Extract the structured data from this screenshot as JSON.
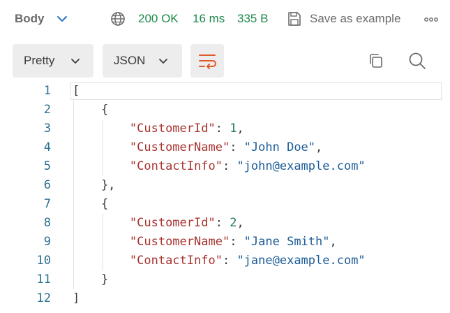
{
  "top_bar": {
    "body_label": "Body",
    "status_code": "200 OK",
    "time": "16 ms",
    "size": "335 B",
    "save_label": "Save as example",
    "status_color": "#1e8a4c",
    "icons": [
      "chevron-down-icon",
      "globe-icon",
      "save-icon",
      "more-horizontal-icon"
    ]
  },
  "toolbar": {
    "format_dropdown": "Pretty",
    "language_dropdown": "JSON",
    "icons": [
      "wrap-lines-icon",
      "copy-icon",
      "search-icon"
    ],
    "accent_color": "#e05a2b"
  },
  "code": {
    "line_numbers": [
      "1",
      "2",
      "3",
      "4",
      "5",
      "6",
      "7",
      "8",
      "9",
      "10",
      "11",
      "12"
    ],
    "lines": [
      [
        {
          "t": "p",
          "v": "["
        }
      ],
      [
        {
          "t": "p",
          "v": "    {"
        }
      ],
      [
        {
          "t": "p",
          "v": "        "
        },
        {
          "t": "k",
          "v": "\"CustomerId\""
        },
        {
          "t": "p",
          "v": ": "
        },
        {
          "t": "n",
          "v": "1"
        },
        {
          "t": "p",
          "v": ","
        }
      ],
      [
        {
          "t": "p",
          "v": "        "
        },
        {
          "t": "k",
          "v": "\"CustomerName\""
        },
        {
          "t": "p",
          "v": ": "
        },
        {
          "t": "s",
          "v": "\"John Doe\""
        },
        {
          "t": "p",
          "v": ","
        }
      ],
      [
        {
          "t": "p",
          "v": "        "
        },
        {
          "t": "k",
          "v": "\"ContactInfo\""
        },
        {
          "t": "p",
          "v": ": "
        },
        {
          "t": "s",
          "v": "\"john@example.com\""
        }
      ],
      [
        {
          "t": "p",
          "v": "    },"
        }
      ],
      [
        {
          "t": "p",
          "v": "    {"
        }
      ],
      [
        {
          "t": "p",
          "v": "        "
        },
        {
          "t": "k",
          "v": "\"CustomerId\""
        },
        {
          "t": "p",
          "v": ": "
        },
        {
          "t": "n",
          "v": "2"
        },
        {
          "t": "p",
          "v": ","
        }
      ],
      [
        {
          "t": "p",
          "v": "        "
        },
        {
          "t": "k",
          "v": "\"CustomerName\""
        },
        {
          "t": "p",
          "v": ": "
        },
        {
          "t": "s",
          "v": "\"Jane Smith\""
        },
        {
          "t": "p",
          "v": ","
        }
      ],
      [
        {
          "t": "p",
          "v": "        "
        },
        {
          "t": "k",
          "v": "\"ContactInfo\""
        },
        {
          "t": "p",
          "v": ": "
        },
        {
          "t": "s",
          "v": "\"jane@example.com\""
        }
      ],
      [
        {
          "t": "p",
          "v": "    }"
        }
      ],
      [
        {
          "t": "p",
          "v": "]"
        }
      ]
    ]
  }
}
